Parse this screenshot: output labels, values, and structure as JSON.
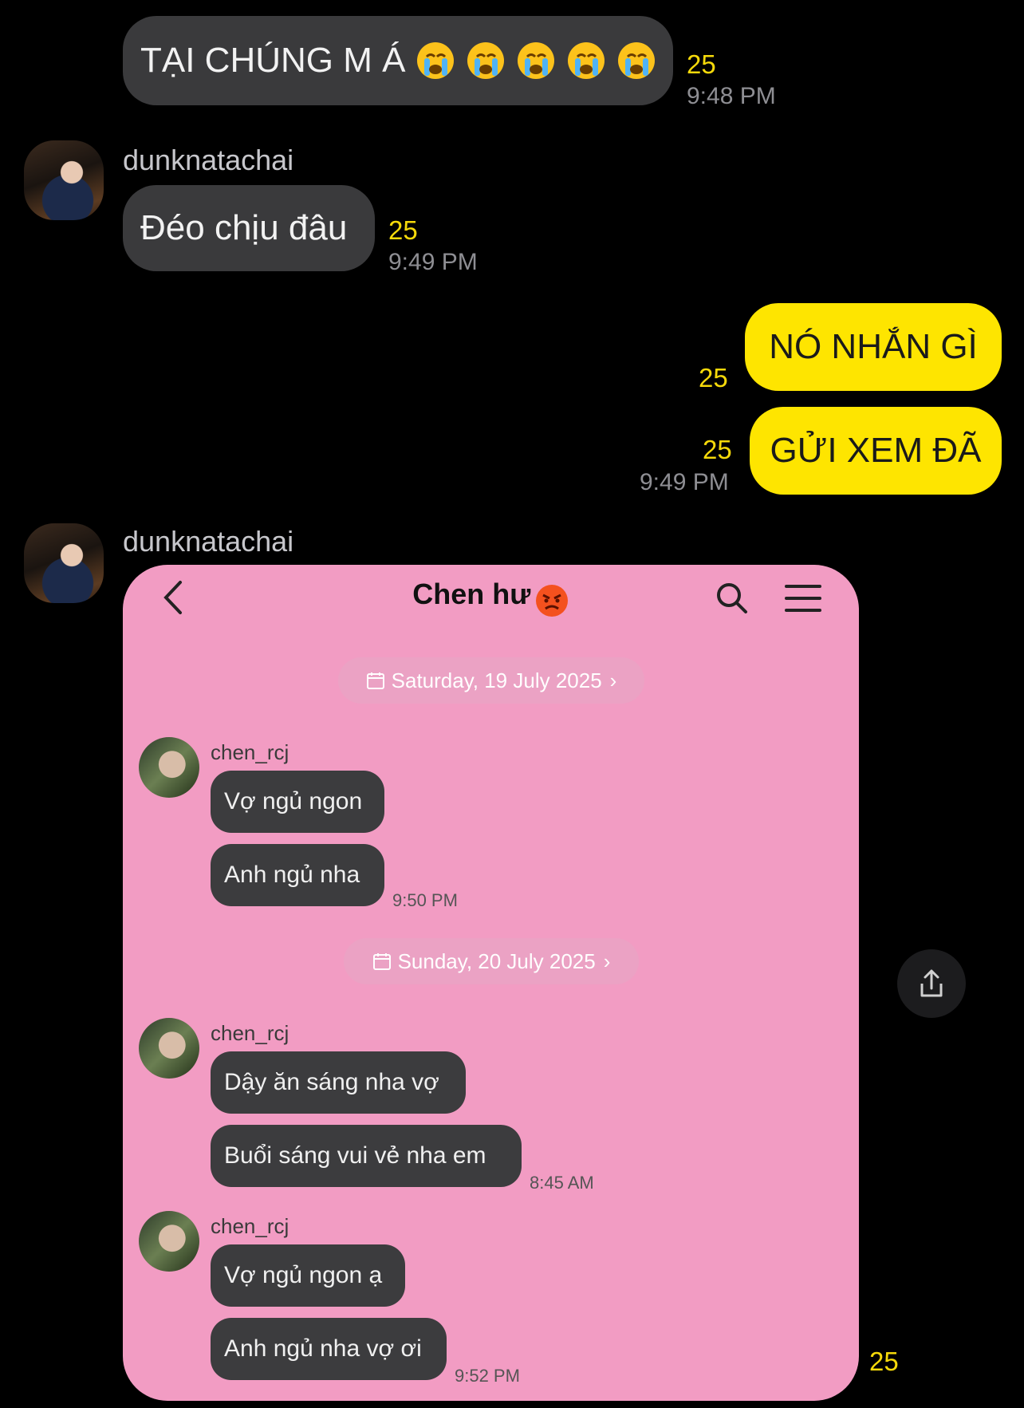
{
  "messages": {
    "m1": {
      "text": "TẠI CHÚNG M Á",
      "emoji": [
        "crying-face",
        "crying-face",
        "crying-face",
        "crying-face",
        "crying-face"
      ],
      "unread": "25",
      "time": "9:48 PM"
    },
    "m2": {
      "sender": "dunknatachai",
      "text": "Đéo chịu đâu",
      "unread": "25",
      "time": "9:49 PM"
    },
    "m3": {
      "text": "NÓ NHẮN GÌ",
      "unread": "25"
    },
    "m4": {
      "text": "GỬI XEM ĐÃ",
      "unread": "25",
      "time": "9:49 PM"
    },
    "m5": {
      "sender": "dunknatachai",
      "unread": "25"
    }
  },
  "screenshot": {
    "title": "Chen hư",
    "title_emoji": "angry-face",
    "date1": "Saturday, 19 July 2025",
    "date2": "Sunday, 20 July 2025",
    "groups": [
      {
        "name": "chen_rcj",
        "msgs": [
          "Vợ ngủ ngon",
          "Anh ngủ nha"
        ],
        "time": "9:50 PM"
      },
      {
        "name": "chen_rcj",
        "msgs": [
          "Dậy ăn sáng nha vợ",
          "Buổi sáng vui vẻ nha em"
        ],
        "time": "8:45 AM"
      },
      {
        "name": "chen_rcj",
        "msgs": [
          "Vợ ngủ ngon ạ",
          "Anh ngủ nha vợ ơi"
        ],
        "time": "9:52 PM"
      }
    ]
  },
  "colors": {
    "bg": "#000000",
    "incoming": "#3a3a3c",
    "outgoing": "#fee500",
    "unread": "#f5d90a",
    "screenshot_bg": "#f29cc3"
  }
}
